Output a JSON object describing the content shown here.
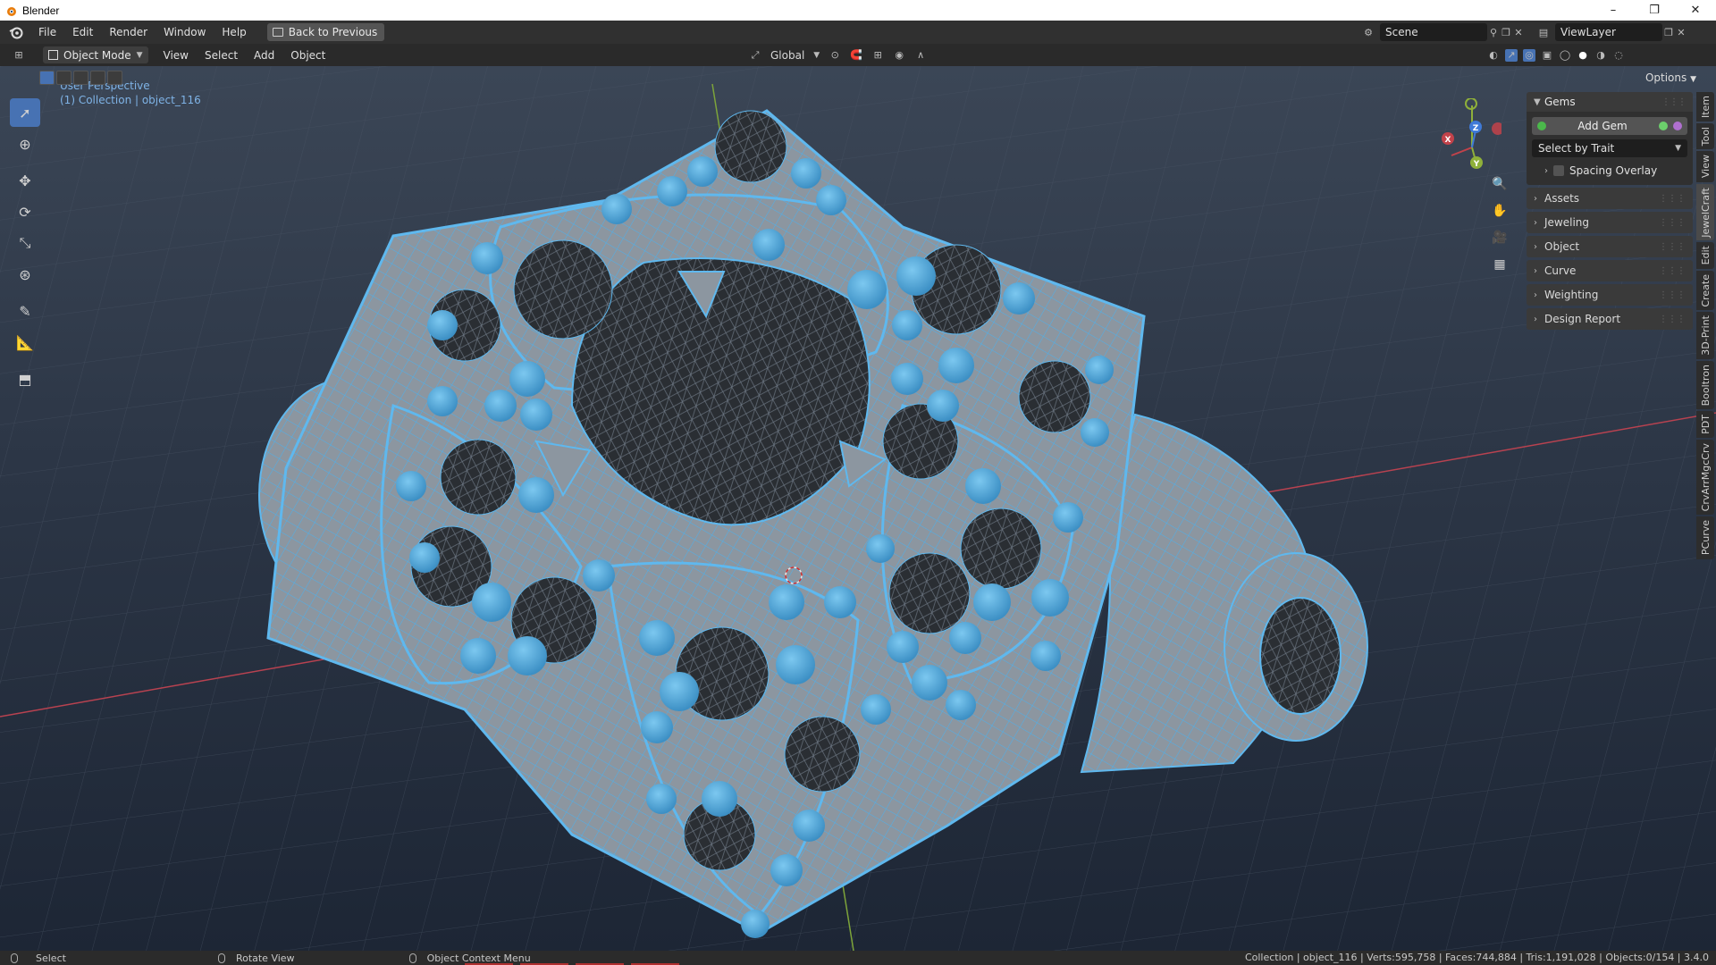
{
  "window": {
    "title": "Blender",
    "controls": [
      "–",
      "❐",
      "✕"
    ]
  },
  "menubar": {
    "items": [
      "File",
      "Edit",
      "Render",
      "Window",
      "Help"
    ],
    "back_button": "Back to Previous",
    "scene": "Scene",
    "view_layer": "ViewLayer"
  },
  "header": {
    "mode": "Object Mode",
    "menus": [
      "View",
      "Select",
      "Add",
      "Object"
    ],
    "transform_orientation": "Global",
    "options": "Options"
  },
  "viewport": {
    "perspective_label": "User Perspective",
    "collection_label": "(1) Collection | object_116",
    "gizmo_axes": [
      "X",
      "Y",
      "Z"
    ],
    "colors": {
      "wire": "#5fb8ee",
      "gem": "#4aa6d8",
      "mesh": "#9aa3ac",
      "x_axis": "#c2424a",
      "y_axis": "#8fb03a",
      "z_axis": "#3f7ad8"
    }
  },
  "tools": [
    "select-box",
    "cursor",
    "move",
    "rotate",
    "scale",
    "transform",
    "annotate",
    "measure",
    "add-cube"
  ],
  "npanel": {
    "gems": {
      "title": "Gems",
      "add_gem": "Add Gem",
      "select_by_trait": "Select by Trait",
      "spacing_overlay": "Spacing Overlay"
    },
    "collapsed_panels": [
      "Assets",
      "Jeweling",
      "Object",
      "Curve",
      "Weighting",
      "Design Report"
    ],
    "tabs": [
      "Item",
      "Tool",
      "View",
      "JewelCraft",
      "Edit",
      "Create",
      "3D-Print",
      "Booltron",
      "PDT",
      "CrvArrMgcCrv",
      "PCurve"
    ],
    "active_tab": "JewelCraft"
  },
  "statusbar": {
    "select": "Select",
    "rotate_view": "Rotate View",
    "context_menu": "Object Context Menu",
    "stats": "Collection | object_116 | Verts:595,758 | Faces:744,884 | Tris:1,191,028 | Objects:0/154 | 3.4.0"
  }
}
